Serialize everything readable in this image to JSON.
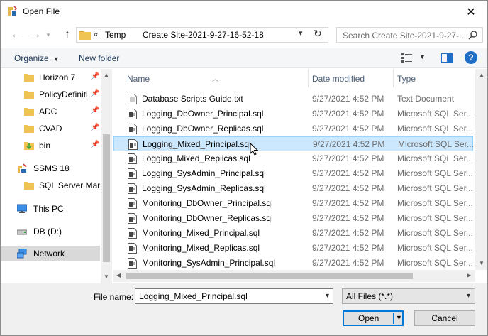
{
  "window": {
    "title": "Open File"
  },
  "address": {
    "overflow": "«",
    "crumbs": [
      "Temp",
      "Create Site-2021-9-27-16-52-18"
    ]
  },
  "search": {
    "placeholder": "Search Create Site-2021-9-27-..."
  },
  "toolbar": {
    "organize": "Organize",
    "new_folder": "New folder",
    "help": "?"
  },
  "nav": {
    "items": [
      {
        "label": "Horizon 7",
        "icon": "folder-icon",
        "pinned": true
      },
      {
        "label": "PolicyDefiniti",
        "icon": "folder-icon",
        "pinned": true
      },
      {
        "label": "ADC",
        "icon": "folder-icon",
        "pinned": true
      },
      {
        "label": "CVAD",
        "icon": "folder-icon",
        "pinned": true
      },
      {
        "label": "bin",
        "icon": "folder-download-icon",
        "pinned": true
      },
      {
        "label": "SSMS 18",
        "icon": "ssms-icon",
        "pinned": false
      },
      {
        "label": "SQL Server Mana",
        "icon": "folder-icon",
        "pinned": false
      },
      {
        "label": "This PC",
        "icon": "computer-icon",
        "pinned": false
      },
      {
        "label": "DB (D:)",
        "icon": "drive-icon",
        "pinned": false
      },
      {
        "label": "Network",
        "icon": "network-icon",
        "pinned": false
      }
    ]
  },
  "columns": {
    "name": "Name",
    "date": "Date modified",
    "type": "Type"
  },
  "files": [
    {
      "name": "Database Scripts Guide.txt",
      "date": "9/27/2021 4:52 PM",
      "type": "Text Document"
    },
    {
      "name": "Logging_DbOwner_Principal.sql",
      "date": "9/27/2021 4:52 PM",
      "type": "Microsoft SQL Ser..."
    },
    {
      "name": "Logging_DbOwner_Replicas.sql",
      "date": "9/27/2021 4:52 PM",
      "type": "Microsoft SQL Ser..."
    },
    {
      "name": "Logging_Mixed_Principal.sql",
      "date": "9/27/2021 4:52 PM",
      "type": "Microsoft SQL Ser..."
    },
    {
      "name": "Logging_Mixed_Replicas.sql",
      "date": "9/27/2021 4:52 PM",
      "type": "Microsoft SQL Ser..."
    },
    {
      "name": "Logging_SysAdmin_Principal.sql",
      "date": "9/27/2021 4:52 PM",
      "type": "Microsoft SQL Ser..."
    },
    {
      "name": "Logging_SysAdmin_Replicas.sql",
      "date": "9/27/2021 4:52 PM",
      "type": "Microsoft SQL Ser..."
    },
    {
      "name": "Monitoring_DbOwner_Principal.sql",
      "date": "9/27/2021 4:52 PM",
      "type": "Microsoft SQL Ser..."
    },
    {
      "name": "Monitoring_DbOwner_Replicas.sql",
      "date": "9/27/2021 4:52 PM",
      "type": "Microsoft SQL Ser..."
    },
    {
      "name": "Monitoring_Mixed_Principal.sql",
      "date": "9/27/2021 4:52 PM",
      "type": "Microsoft SQL Ser..."
    },
    {
      "name": "Monitoring_Mixed_Replicas.sql",
      "date": "9/27/2021 4:52 PM",
      "type": "Microsoft SQL Ser..."
    },
    {
      "name": "Monitoring_SysAdmin_Principal.sql",
      "date": "9/27/2021 4:52 PM",
      "type": "Microsoft SQL Ser..."
    }
  ],
  "selected_file": "Logging_Mixed_Principal.sql",
  "filename": {
    "label": "File name:",
    "value": "Logging_Mixed_Principal.sql"
  },
  "filetype": {
    "value": "All Files (*.*)"
  },
  "buttons": {
    "open": "Open",
    "cancel": "Cancel"
  },
  "colors": {
    "accent": "#0078d7",
    "selection": "#cce8ff",
    "folder": "#e8b84a"
  }
}
